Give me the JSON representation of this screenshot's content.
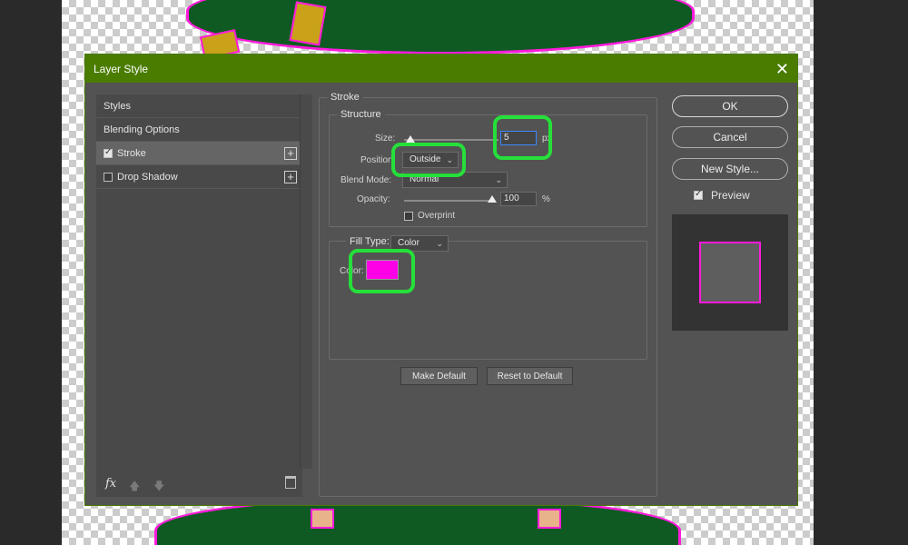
{
  "dialog": {
    "title": "Layer Style",
    "close_glyph": "✕"
  },
  "styles_panel": {
    "items": [
      {
        "label": "Styles"
      },
      {
        "label": "Blending Options"
      },
      {
        "label": "Stroke",
        "checked": true,
        "selected": true
      },
      {
        "label": "Drop Shadow",
        "checked": false
      }
    ],
    "footer": {
      "fx_label": "fx",
      "move_up_glyph": "🡅",
      "move_down_glyph": "🡇"
    }
  },
  "stroke": {
    "group_label": "Stroke",
    "structure": {
      "group_label": "Structure",
      "size_label": "Size:",
      "size_value": "5",
      "size_unit": "px",
      "position_label": "Position:",
      "position_value": "Outside",
      "blend_mode_label": "Blend Mode:",
      "blend_mode_value": "Normal",
      "opacity_label": "Opacity:",
      "opacity_value": "100",
      "opacity_unit": "%",
      "overprint_label": "Overprint",
      "overprint_checked": false
    },
    "fill": {
      "fill_type_label": "Fill Type:",
      "fill_type_value": "Color",
      "color_label": "Color:",
      "color_value": "#ff00e6"
    },
    "make_default_label": "Make Default",
    "reset_default_label": "Reset to Default"
  },
  "actions": {
    "ok_label": "OK",
    "cancel_label": "Cancel",
    "new_style_label": "New Style...",
    "preview_label": "Preview",
    "preview_checked": true
  },
  "colors": {
    "titlebar": "#4a7c00",
    "stroke_color": "#ff00e6",
    "annotation_highlight": "#25e03a"
  }
}
